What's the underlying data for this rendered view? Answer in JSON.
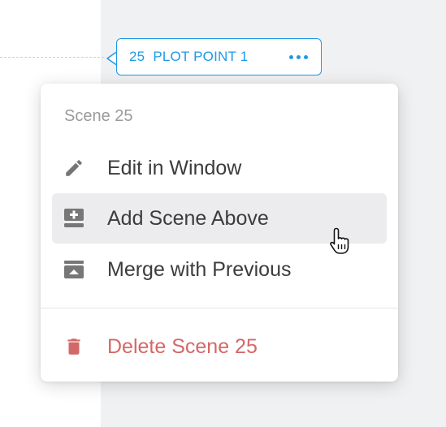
{
  "plot_point": {
    "number": "25",
    "title": "PLOT POINT 1",
    "more_icon": "ellipsis-icon",
    "color": "#1e9ae6"
  },
  "menu": {
    "header": "Scene 25",
    "items": [
      {
        "label": "Edit in Window",
        "icon": "pencil-icon"
      },
      {
        "label": "Add Scene Above",
        "icon": "add-scene-above-icon"
      },
      {
        "label": "Merge with Previous",
        "icon": "merge-icon"
      }
    ],
    "danger_item": {
      "label": "Delete Scene 25",
      "icon": "trash-icon",
      "color": "#d46767"
    }
  }
}
